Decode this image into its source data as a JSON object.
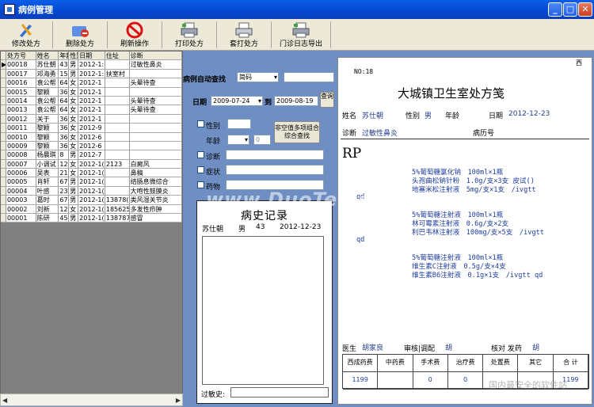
{
  "window": {
    "title": "病例管理",
    "min": "_",
    "max": "□",
    "close": "✕"
  },
  "toolbar": [
    {
      "label": "修改处方",
      "icon": "edit-tools-icon"
    },
    {
      "label": "删除处方",
      "icon": "delete-folder-icon"
    },
    {
      "label": "刷新操作",
      "icon": "no-entry-icon"
    },
    {
      "label": "打印处方",
      "icon": "printer-icon"
    },
    {
      "label": "套打处方",
      "icon": "printer-icon"
    },
    {
      "label": "门诊日志导出",
      "icon": "printer-icon"
    }
  ],
  "grid": {
    "headers": [
      "",
      "处方号",
      "姓名",
      "年龄",
      "性别",
      "日期",
      "住址",
      "诊断"
    ],
    "rows": [
      [
        "▶",
        "00018",
        "苏仕朝",
        "43",
        "男",
        "2012-1:",
        "",
        "过敏性鼻炎"
      ],
      [
        "",
        "00017",
        "邓海勇",
        "15",
        "男",
        "2012-1:",
        "扶室村",
        ""
      ],
      [
        "",
        "00016",
        "袁公帮",
        "64",
        "女",
        "2012-1",
        "",
        "头晕待查"
      ],
      [
        "",
        "00015",
        "黎颖",
        "36",
        "女",
        "2012-1",
        "",
        ""
      ],
      [
        "",
        "00014",
        "袁公帮",
        "64",
        "女",
        "2012-1",
        "",
        "头晕待查"
      ],
      [
        "",
        "00013",
        "袁公帮",
        "64",
        "女",
        "2012-1",
        "",
        "头晕待查"
      ],
      [
        "",
        "00012",
        "关于",
        "36",
        "女",
        "2012-1",
        "",
        ""
      ],
      [
        "",
        "00011",
        "黎颖",
        "36",
        "女",
        "2012-9",
        "",
        ""
      ],
      [
        "",
        "00010",
        "黎颖",
        "36",
        "女",
        "2012-6",
        "",
        ""
      ],
      [
        "",
        "00009",
        "黎颖",
        "36",
        "女",
        "2012-6",
        "",
        ""
      ],
      [
        "",
        "00008",
        "杨晨琪",
        "8",
        "男",
        "2012-7",
        "",
        ""
      ],
      [
        "",
        "00007",
        "小调试",
        "12",
        "女",
        "2012-1(",
        "2123",
        "白癜风"
      ],
      [
        "",
        "00006",
        "吴表",
        "21",
        "女",
        "2012-1(",
        "",
        "鼻稿"
      ],
      [
        "",
        "00005",
        "肖轩",
        "67",
        "男",
        "2012-1(",
        "",
        "结肠息微综合"
      ],
      [
        "",
        "00004",
        "叶感",
        "23",
        "男",
        "2012-1(",
        "",
        "大咆性鼓膜炎"
      ],
      [
        "",
        "00003",
        "葛时",
        "67",
        "男",
        "2012-1(",
        "13878(",
        "类风湿关节炎"
      ],
      [
        "",
        "00002",
        "刘新",
        "12",
        "女",
        "2012-1(",
        "1856254",
        "多发性疖肿"
      ],
      [
        "",
        "00001",
        "陈研",
        "45",
        "男",
        "2012-1(",
        "1387875",
        "感冒"
      ]
    ],
    "scroll_left": "◀",
    "scroll_right": "▶"
  },
  "search": {
    "auto_label": "病例自动查找",
    "mode_value": "简码",
    "date_label": "日期",
    "date_from": "2009-07-24",
    "to_label": "到",
    "date_to": "2009-08-19",
    "query_button": "查询",
    "gender_label": "性别",
    "age_label": "年龄",
    "age_value": "0",
    "clear_button": "非空值多项组合综合查找",
    "diagnosis_label": "诊断",
    "symptom_label": "症状",
    "drug_label": "药物"
  },
  "history": {
    "title": "病史记录",
    "name": "苏仕朝",
    "gender": "男",
    "age": "43",
    "date": "2012-12-23",
    "allergy_label": "过敏史:"
  },
  "rx": {
    "no_label": "NO:18",
    "corner": "西",
    "title": "大城镇卫生室处方笺",
    "name_label": "姓名",
    "name": "苏仕朝",
    "gender_label": "性别",
    "gender": "男",
    "age_label": "年龄",
    "date_label": "日期",
    "date": "2012-12-23",
    "diagnosis_label": "诊断",
    "diagnosis": "过敏性鼻炎",
    "record_label": "病历号",
    "rp": "RP",
    "groups": [
      {
        "lines": [
          "5%葡萄糖氯化钠　100ml×1瓶",
          "头孢曲松钠针粉　1.0g/支×3支 皮试()",
          "地塞米松注射液　5mg/支×1支　/ivgtt"
        ],
        "freq": "qd"
      },
      {
        "lines": [
          "5%葡萄糖注射液　100ml×1瓶",
          "林可霉素注射液　0.6g/支×2支",
          "利巴韦林注射液　100mg/支×5支　/ivgtt"
        ],
        "freq": "qd"
      },
      {
        "lines": [
          "5%葡萄糖注射液　100ml×1瓶",
          "维生素C注射液　0.5g/支×4支",
          "维生素B6注射液　0.1g×1支　/ivgtt qd"
        ],
        "freq": ""
      }
    ],
    "doctor_label": "医生",
    "doctor": "胡家良",
    "review_label": "审核|调配",
    "review": "胡",
    "check_label": "核对 发药",
    "check": "胡",
    "fee_headers": [
      "西成药费",
      "中药费",
      "手术费",
      "治疗费",
      "处置费",
      "其它",
      "合 计"
    ],
    "fee_values": [
      "1199",
      "",
      "0",
      "0",
      "",
      "",
      "1199"
    ]
  },
  "watermark": "www.DuoTe.com",
  "watermark2": "国内最安全的软件站"
}
